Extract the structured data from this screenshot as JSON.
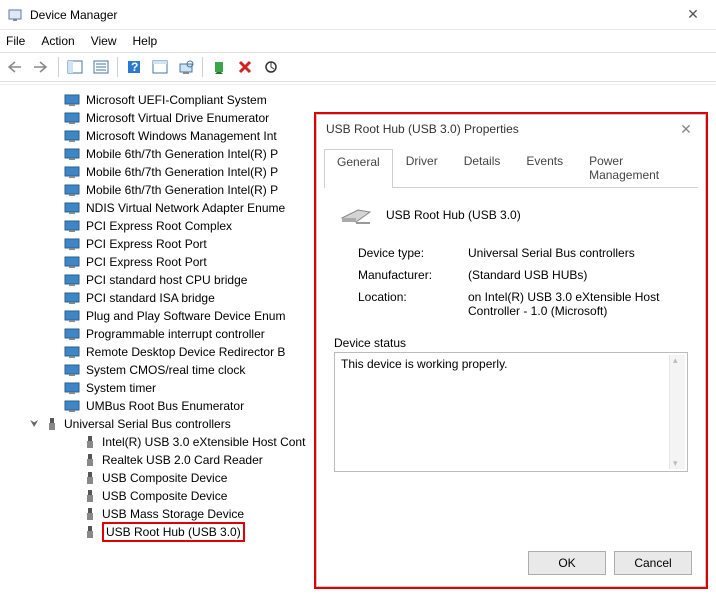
{
  "window": {
    "title": "Device Manager"
  },
  "menu": {
    "file": "File",
    "action": "Action",
    "view": "View",
    "help": "Help"
  },
  "tree": {
    "items": [
      "Microsoft UEFI-Compliant System",
      "Microsoft Virtual Drive Enumerator",
      "Microsoft Windows Management Int",
      "Mobile 6th/7th Generation Intel(R) P",
      "Mobile 6th/7th Generation Intel(R) P",
      "Mobile 6th/7th Generation Intel(R) P",
      "NDIS Virtual Network Adapter Enume",
      "PCI Express Root Complex",
      "PCI Express Root Port",
      "PCI Express Root Port",
      "PCI standard host CPU bridge",
      "PCI standard ISA bridge",
      "Plug and Play Software Device Enum",
      "Programmable interrupt controller",
      "Remote Desktop Device Redirector B",
      "System CMOS/real time clock",
      "System timer",
      "UMBus Root Bus Enumerator"
    ],
    "usb_category": "Universal Serial Bus controllers",
    "usb_items": [
      "Intel(R) USB 3.0 eXtensible Host Cont",
      "Realtek USB 2.0 Card Reader",
      "USB Composite Device",
      "USB Composite Device",
      "USB Mass Storage Device",
      "USB Root Hub (USB 3.0)"
    ]
  },
  "dialog": {
    "title": "USB Root Hub (USB 3.0) Properties",
    "tabs": {
      "general": "General",
      "driver": "Driver",
      "details": "Details",
      "events": "Events",
      "power": "Power Management"
    },
    "device_name": "USB Root Hub (USB 3.0)",
    "labels": {
      "type": "Device type:",
      "mfr": "Manufacturer:",
      "loc": "Location:",
      "status_legend": "Device status"
    },
    "values": {
      "type": "Universal Serial Bus controllers",
      "mfr": "(Standard USB HUBs)",
      "loc": "on Intel(R) USB 3.0 eXtensible Host Controller - 1.0 (Microsoft)"
    },
    "status": "This device is working properly.",
    "buttons": {
      "ok": "OK",
      "cancel": "Cancel"
    }
  }
}
